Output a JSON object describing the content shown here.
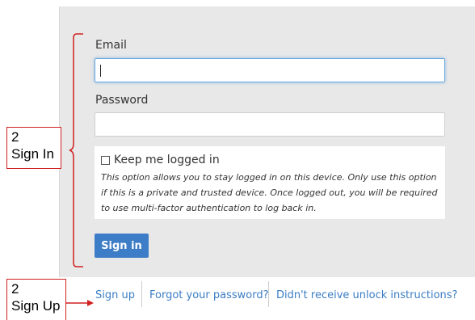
{
  "form": {
    "email_label": "Email",
    "email_value": "",
    "password_label": "Password",
    "password_value": "",
    "keep_logged_in_label": "Keep me logged in",
    "keep_logged_in_checked": false,
    "notice_text": "This option allows you to stay logged in on this device. Only use this option if this is a private and trusted device. Once logged out, you will be required to use multi-factor authentication to log back in.",
    "signin_label": "Sign in"
  },
  "links": {
    "signup": "Sign up",
    "forgot_password": "Forgot your password?",
    "unlock": "Didn't receive unlock instructions?"
  },
  "annotations": {
    "signin_callout_num": "2",
    "signin_callout_text": "Sign In",
    "signup_callout_num": "2",
    "signup_callout_text": "Sign Up"
  },
  "colors": {
    "accent": "#3d7cc6",
    "link": "#3b7dc4",
    "annotation": "#d02020",
    "panel_bg": "#e8e8e8"
  }
}
